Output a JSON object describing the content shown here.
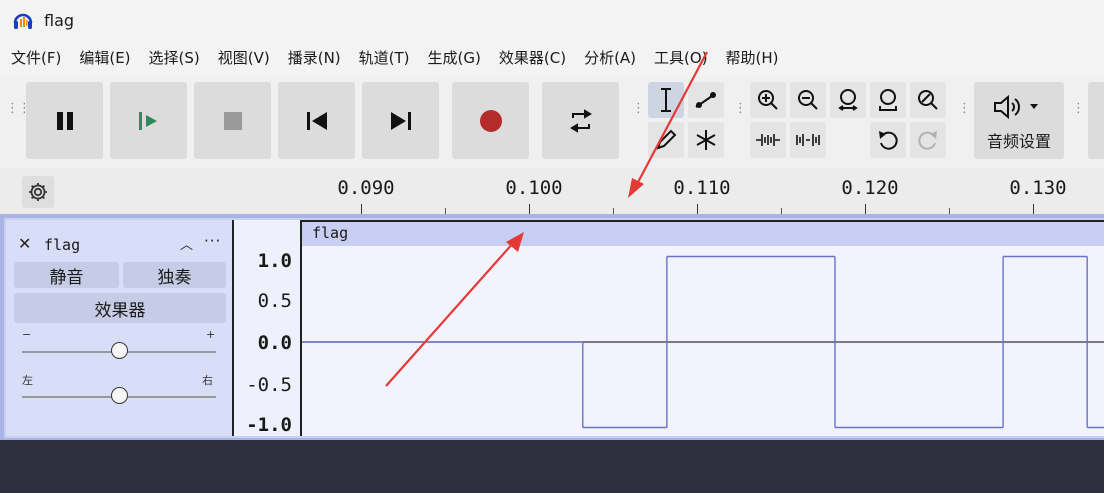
{
  "window": {
    "title": "flag"
  },
  "menu": [
    "文件(F)",
    "编辑(E)",
    "选择(S)",
    "视图(V)",
    "播录(N)",
    "轨道(T)",
    "生成(G)",
    "效果器(C)",
    "分析(A)",
    "工具(O)",
    "帮助(H)"
  ],
  "toolbar": {
    "transport": [
      {
        "name": "pause-button",
        "icon": "pause-icon"
      },
      {
        "name": "play-button",
        "icon": "play-icon"
      },
      {
        "name": "stop-button",
        "icon": "stop-icon"
      },
      {
        "name": "skip-start-button",
        "icon": "skip-start-icon"
      },
      {
        "name": "skip-end-button",
        "icon": "skip-end-icon"
      },
      {
        "name": "record-button",
        "icon": "record-icon"
      },
      {
        "name": "loop-button",
        "icon": "loop-icon"
      }
    ],
    "audio_setup_label": "音频设置",
    "accent_green": "#2e8a5e",
    "record_red": "#b52a2a"
  },
  "ruler": {
    "ticks": [
      "0.090",
      "0.100",
      "0.110",
      "0.120",
      "0.130"
    ]
  },
  "track": {
    "name": "flag",
    "mute_label": "静音",
    "solo_label": "独奏",
    "effects_label": "效果器",
    "gain_min": "−",
    "gain_max": "+",
    "pan_left": "左",
    "pan_right": "右",
    "gain_level": 0.5,
    "pan_level": 0.5
  },
  "vruler": {
    "labels": [
      "1.0",
      "0.5",
      "0.0",
      "-0.5",
      "-1.0"
    ]
  },
  "clip": {
    "title": "flag"
  },
  "waveform": {
    "wave_color": "#6a72c8",
    "time_start": 0.0833,
    "time_end": 0.131,
    "amplitude_high": 0.9,
    "amplitude_low": -0.9,
    "segments": [
      {
        "t0": 0.0833,
        "t1": 0.1,
        "level": 0.0
      },
      {
        "t0": 0.1,
        "t1": 0.105,
        "level": -0.9
      },
      {
        "t0": 0.105,
        "t1": 0.115,
        "level": 0.9
      },
      {
        "t0": 0.115,
        "t1": 0.125,
        "level": -0.9
      },
      {
        "t0": 0.125,
        "t1": 0.13,
        "level": 0.9
      },
      {
        "t0": 0.13,
        "t1": 0.131,
        "level": -0.9
      }
    ]
  },
  "annotation": {
    "arrow_color": "#e53935"
  }
}
